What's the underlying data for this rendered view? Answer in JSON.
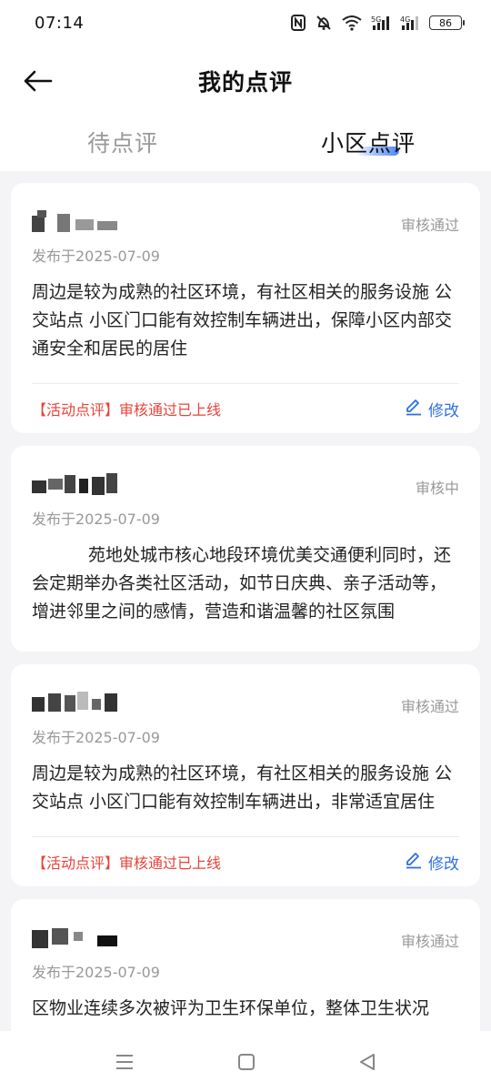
{
  "status_bar": {
    "time": "07:14",
    "battery": "86",
    "icons": [
      "nfc-icon",
      "mute-bell-icon",
      "wifi-icon",
      "signal-5g-icon",
      "signal-4g-icon",
      "battery-icon"
    ]
  },
  "header": {
    "title": "我的点评",
    "back_icon": "back-arrow-icon"
  },
  "tabs": [
    {
      "label": "待点评",
      "active": false
    },
    {
      "label": "小区点评",
      "active": true
    }
  ],
  "reviews": [
    {
      "name": "",
      "status": "审核通过",
      "date": "发布于2025-07-09",
      "content": "周边是较为成熟的社区环境，有社区相关的服务设施 公交站点 小区门口能有效控制车辆进出，保障小区内部交通安全和居民的居住",
      "promo": "【活动点评】审核通过已上线",
      "edit_label": "修改"
    },
    {
      "name": "",
      "status": "审核中",
      "date": "发布于2025-07-09",
      "content": "苑地处城市核心地段环境优美交通便利同时，还会定期举办各类社区活动，如节日庆典、亲子活动等，增进邻里之间的感情，营造和谐温馨的社区氛围"
    },
    {
      "name": "",
      "status": "审核通过",
      "date": "发布于2025-07-09",
      "content": "周边是较为成熟的社区环境，有社区相关的服务设施 公交站点 小区门口能有效控制车辆进出，非常适宜居住",
      "promo": "【活动点评】审核通过已上线",
      "edit_label": "修改"
    },
    {
      "name": "",
      "status": "审核通过",
      "date": "发布于2025-07-09",
      "content": "区物业连续多次被评为卫生环保单位，整体卫生状况"
    }
  ],
  "nav_bar": {
    "icons": [
      "menu-icon",
      "home-square-icon",
      "back-triangle-icon"
    ]
  },
  "colors": {
    "accent": "#2f6fe4",
    "promo": "#e8433a",
    "muted": "#999999",
    "background": "#f4f4f6"
  }
}
